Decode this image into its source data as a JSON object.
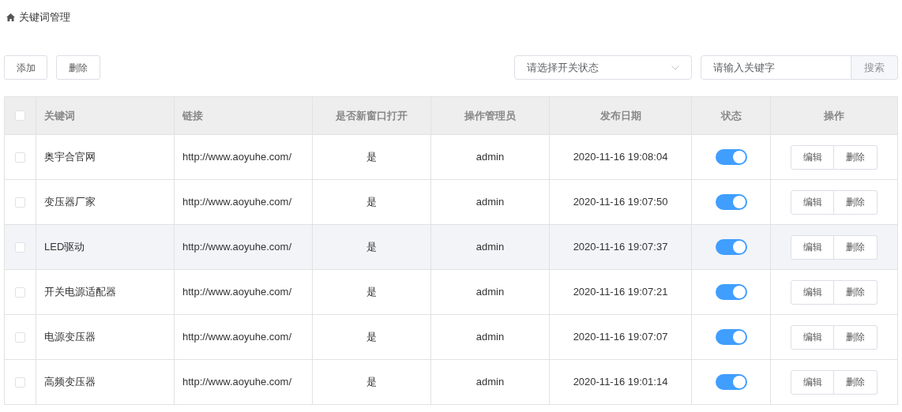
{
  "breadcrumb": {
    "title": "关键词管理"
  },
  "toolbar": {
    "buttons": [
      "添加",
      "删除"
    ],
    "status_select": {
      "placeholder": "请选择开关状态"
    },
    "search": {
      "placeholder": "请输入关键字",
      "button": "搜索"
    }
  },
  "table": {
    "select_all": {
      "checked": false
    },
    "columns": [
      "关键词",
      "链接",
      "是否新窗口打开",
      "操作管理员",
      "发布日期",
      "状态",
      "操作"
    ],
    "rows": [
      {
        "checked": false,
        "hovered": false,
        "keyword": "奥宇合官网",
        "link": "http://www.aoyuhe.com/",
        "new_window": "是",
        "admin": "admin",
        "date": "2020-11-16 19:08:04",
        "on": true,
        "actions": [
          "编辑",
          "删除"
        ]
      },
      {
        "checked": false,
        "hovered": false,
        "keyword": "变压器厂家",
        "link": "http://www.aoyuhe.com/",
        "new_window": "是",
        "admin": "admin",
        "date": "2020-11-16 19:07:50",
        "on": true,
        "actions": [
          "编辑",
          "删除"
        ]
      },
      {
        "checked": false,
        "hovered": true,
        "keyword": "LED驱动",
        "link": "http://www.aoyuhe.com/",
        "new_window": "是",
        "admin": "admin",
        "date": "2020-11-16 19:07:37",
        "on": true,
        "actions": [
          "编辑",
          "删除"
        ]
      },
      {
        "checked": false,
        "hovered": false,
        "keyword": "开关电源适配器",
        "link": "http://www.aoyuhe.com/",
        "new_window": "是",
        "admin": "admin",
        "date": "2020-11-16 19:07:21",
        "on": true,
        "actions": [
          "编辑",
          "删除"
        ]
      },
      {
        "checked": false,
        "hovered": false,
        "keyword": "电源变压器",
        "link": "http://www.aoyuhe.com/",
        "new_window": "是",
        "admin": "admin",
        "date": "2020-11-16 19:07:07",
        "on": true,
        "actions": [
          "编辑",
          "删除"
        ]
      },
      {
        "checked": false,
        "hovered": false,
        "keyword": "高频变压器",
        "link": "http://www.aoyuhe.com/",
        "new_window": "是",
        "admin": "admin",
        "date": "2020-11-16 19:01:14",
        "on": true,
        "actions": [
          "编辑",
          "删除"
        ]
      }
    ]
  }
}
